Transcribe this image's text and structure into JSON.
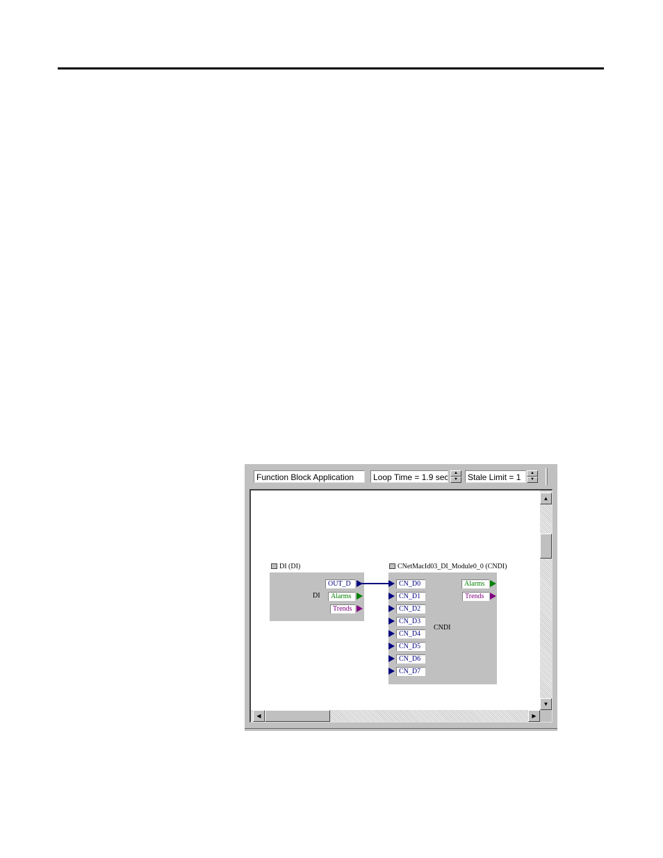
{
  "toolbar": {
    "app_field": "Function Block Application",
    "loop_time": "Loop Time = 1.9 sec",
    "stale_limit": "Stale Limit = 1"
  },
  "blocks": {
    "di": {
      "title": "DI (DI)",
      "name": "DI",
      "ports_out": [
        "OUT_D",
        "Alarms",
        "Trends"
      ]
    },
    "cndi": {
      "title": "CNetMacId03_DI_Module0_0 (CNDI)",
      "name": "CNDI",
      "ports_in": [
        "CN_D0",
        "CN_D1",
        "CN_D2",
        "CN_D3",
        "CN_D4",
        "CN_D5",
        "CN_D6",
        "CN_D7"
      ],
      "ports_out": [
        "Alarms",
        "Trends"
      ]
    }
  },
  "colors": {
    "input_port_text": "#000080",
    "alarms": "#008000",
    "trends": "#800080",
    "wire": "#000080",
    "block_fill": "#c0c0c0"
  }
}
